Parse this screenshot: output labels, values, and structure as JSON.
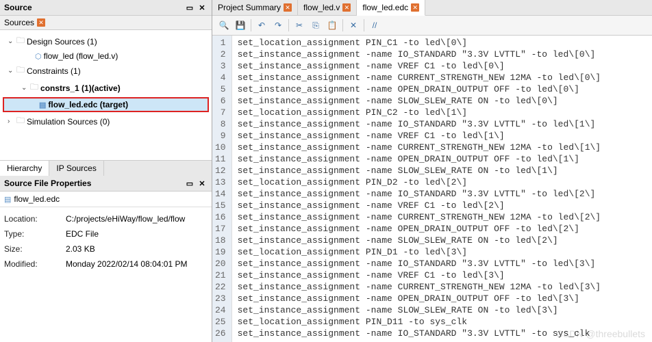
{
  "source_panel": {
    "title": "Source",
    "sub_label": "Sources",
    "tabs": {
      "hierarchy": "Hierarchy",
      "ip_sources": "IP Sources"
    }
  },
  "tree": {
    "design_sources": "Design Sources (1)",
    "flow_led_v": "flow_led (flow_led.v)",
    "constraints": "Constraints (1)",
    "constrs_1": "constrs_1 (1)(active)",
    "flow_led_edc": "flow_led.edc (target)",
    "sim_sources": "Simulation Sources (0)"
  },
  "props": {
    "title": "Source File Properties",
    "file": "flow_led.edc",
    "rows": {
      "location_label": "Location:",
      "location_val": "C:/projects/eHiWay/flow_led/flow",
      "type_label": "Type:",
      "type_val": "EDC File",
      "size_label": "Size:",
      "size_val": "2.03 KB",
      "modified_label": "Modified:",
      "modified_val": "Monday 2022/02/14 08:04:01 PM"
    }
  },
  "editor_tabs": {
    "project_summary": "Project Summary",
    "flow_led_v": "flow_led.v",
    "flow_led_edc": "flow_led.edc"
  },
  "code": [
    "set_location_assignment PIN_C1 -to led\\[0\\]",
    "set_instance_assignment -name IO_STANDARD \"3.3V LVTTL\" -to led\\[0\\]",
    "set_instance_assignment -name VREF C1 -to led\\[0\\]",
    "set_instance_assignment -name CURRENT_STRENGTH_NEW 12MA -to led\\[0\\]",
    "set_instance_assignment -name OPEN_DRAIN_OUTPUT OFF -to led\\[0\\]",
    "set_instance_assignment -name SLOW_SLEW_RATE ON -to led\\[0\\]",
    "set_location_assignment PIN_C2 -to led\\[1\\]",
    "set_instance_assignment -name IO_STANDARD \"3.3V LVTTL\" -to led\\[1\\]",
    "set_instance_assignment -name VREF C1 -to led\\[1\\]",
    "set_instance_assignment -name CURRENT_STRENGTH_NEW 12MA -to led\\[1\\]",
    "set_instance_assignment -name OPEN_DRAIN_OUTPUT OFF -to led\\[1\\]",
    "set_instance_assignment -name SLOW_SLEW_RATE ON -to led\\[1\\]",
    "set_location_assignment PIN_D2 -to led\\[2\\]",
    "set_instance_assignment -name IO_STANDARD \"3.3V LVTTL\" -to led\\[2\\]",
    "set_instance_assignment -name VREF C1 -to led\\[2\\]",
    "set_instance_assignment -name CURRENT_STRENGTH_NEW 12MA -to led\\[2\\]",
    "set_instance_assignment -name OPEN_DRAIN_OUTPUT OFF -to led\\[2\\]",
    "set_instance_assignment -name SLOW_SLEW_RATE ON -to led\\[2\\]",
    "set_location_assignment PIN_D1 -to led\\[3\\]",
    "set_instance_assignment -name IO_STANDARD \"3.3V LVTTL\" -to led\\[3\\]",
    "set_instance_assignment -name VREF C1 -to led\\[3\\]",
    "set_instance_assignment -name CURRENT_STRENGTH_NEW 12MA -to led\\[3\\]",
    "set_instance_assignment -name OPEN_DRAIN_OUTPUT OFF -to led\\[3\\]",
    "set_instance_assignment -name SLOW_SLEW_RATE ON -to led\\[3\\]",
    "set_location_assignment PIN_D11 -to sys_clk",
    "set_instance_assignment -name IO_STANDARD \"3.3V LVTTL\" -to sys_clk"
  ],
  "watermark": "CSDN @threebullets"
}
